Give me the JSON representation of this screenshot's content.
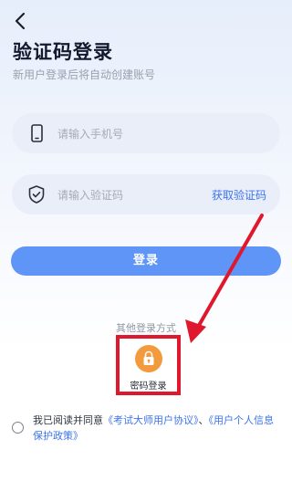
{
  "header": {
    "title": "验证码登录",
    "subtitle": "新用户登录后将自动创建账号"
  },
  "phone": {
    "placeholder": "请输入手机号"
  },
  "code": {
    "placeholder": "请输入验证码",
    "get_code_label": "获取验证码"
  },
  "login_button": "登录",
  "other_methods": {
    "title": "其他登录方式",
    "password_login_label": "密码登录"
  },
  "agreement": {
    "prefix": "我已阅读并同意",
    "link1": "《考试大师用户协议》",
    "sep": "、",
    "link2": "《用户个人信息保护政策》"
  },
  "colors": {
    "accent": "#3d74ef",
    "button": "#5f95f6",
    "highlight": "#e0182d",
    "lock_badge": "#f39a3d"
  },
  "icons": [
    "back-arrow-icon",
    "phone-icon",
    "shield-icon",
    "lock-icon"
  ]
}
